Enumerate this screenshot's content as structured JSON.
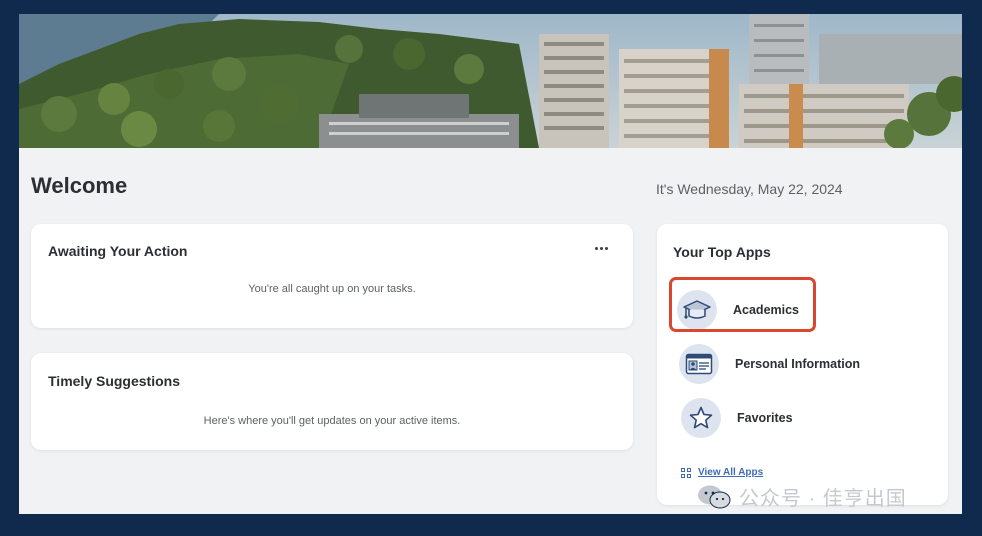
{
  "page": {
    "welcome_title": "Welcome",
    "date_text": "It's Wednesday, May 22, 2024"
  },
  "awaiting_card": {
    "title": "Awaiting Your Action",
    "message": "You're all caught up on your tasks.",
    "more_icon": "more-horizontal-icon"
  },
  "timely_card": {
    "title": "Timely Suggestions",
    "message": "Here's where you'll get updates on your active items."
  },
  "top_apps": {
    "title": "Your Top Apps",
    "items": [
      {
        "label": "Academics",
        "icon": "graduation-cap-icon"
      },
      {
        "label": "Personal Information",
        "icon": "id-card-icon"
      },
      {
        "label": "Favorites",
        "icon": "star-icon"
      }
    ],
    "view_all_label": "View All Apps",
    "view_all_icon": "grid-icon",
    "highlight_color": "#d9472e"
  },
  "watermark": {
    "text": "公众号 · 佳亨出国"
  },
  "colors": {
    "outer_background": "#0f2a4d",
    "page_background": "#f1f2f4",
    "link": "#3b6cb7",
    "icon_circle": "#dde4ef"
  }
}
